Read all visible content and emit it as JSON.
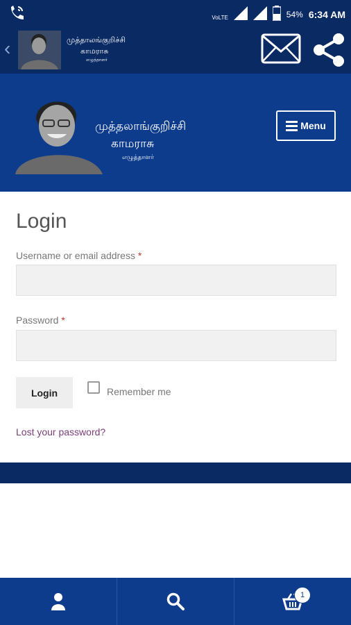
{
  "status_bar": {
    "network": "VoLTE",
    "lte": "LTE",
    "battery": "54%",
    "time": "6:34 AM"
  },
  "app_bar": {
    "brand_line1": "முத்தாலங்குறிச்சி",
    "brand_line2": "காமராசு",
    "brand_line3": "எழுத்தாளர்"
  },
  "hero": {
    "brand_line1": "முத்தலாங்குறிச்சி",
    "brand_line2": "காமராசு",
    "brand_line3": "எழுத்தாளர்",
    "menu_label": "Menu"
  },
  "login": {
    "title": "Login",
    "username_label": "Username or email address",
    "password_label": "Password",
    "required_mark": "*",
    "submit_label": "Login",
    "remember_label": "Remember me",
    "lost_password": "Lost your password?"
  },
  "bottom_nav": {
    "cart_count": "1",
    "items": [
      "account-icon",
      "search-icon",
      "cart-icon"
    ]
  },
  "colors": {
    "header_dark": "#0a2a63",
    "header_blue": "#0d3c8c",
    "link": "#7b3e78",
    "required": "#c0392b"
  }
}
